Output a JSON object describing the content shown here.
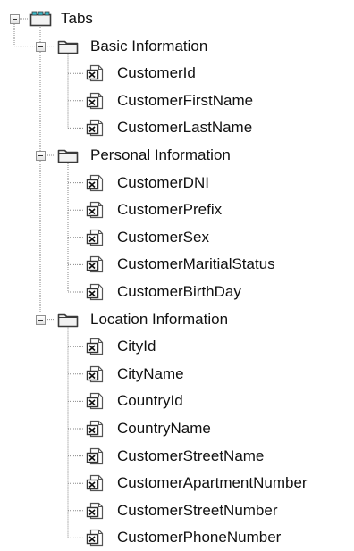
{
  "tree": {
    "root": {
      "label": "Tabs",
      "icon": "tabs-icon"
    },
    "groups": [
      {
        "label": "Basic Information",
        "icon": "folder-icon",
        "items": [
          "CustomerId",
          "CustomerFirstName",
          "CustomerLastName"
        ]
      },
      {
        "label": "Personal Information",
        "icon": "folder-icon",
        "items": [
          "CustomerDNI",
          "CustomerPrefix",
          "CustomerSex",
          "CustomerMaritialStatus",
          "CustomerBirthDay"
        ]
      },
      {
        "label": "Location Information",
        "icon": "folder-icon",
        "items": [
          "CityId",
          "CityName",
          "CountryId",
          "CountryName",
          "CustomerStreetName",
          "CustomerApartmentNumber",
          "CustomerStreetNumber",
          "CustomerPhoneNumber"
        ]
      }
    ],
    "item_icon": "attribute-icon",
    "colors": {
      "folder": "#f2f2f2",
      "folder_border": "#3a3a3a",
      "tabs_accent": "#36b8c8",
      "tree_line": "#8a8a8a"
    }
  }
}
